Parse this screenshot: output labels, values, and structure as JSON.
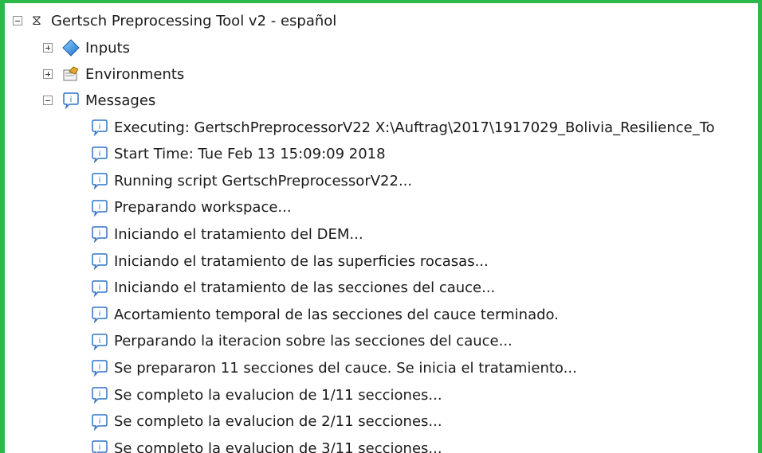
{
  "tree": {
    "root": {
      "label": "Gertsch Preprocessing Tool v2 - español",
      "icon": "hourglass-icon"
    },
    "nodes": [
      {
        "label": "Inputs",
        "icon": "inputs-diamond-icon",
        "expanded": false
      },
      {
        "label": "Environments",
        "icon": "environments-icon",
        "expanded": false
      },
      {
        "label": "Messages",
        "icon": "info-balloon-icon",
        "expanded": true
      }
    ],
    "messages": [
      "Executing: GertschPreprocessorV22 X:\\Auftrag\\2017\\1917029_Bolivia_Resilience_To",
      "Start Time: Tue Feb 13 15:09:09 2018",
      "Running script GertschPreprocessorV22...",
      "Preparando workspace...",
      "Iniciando el tratamiento del DEM...",
      "Iniciando el tratamiento de las superficies rocasas...",
      "Iniciando el tratamiento de las secciones del cauce...",
      "Acortamiento temporal de las secciones del cauce terminado.",
      "Perparando la iteracion sobre las secciones del cauce...",
      "Se prepararon 11 secciones del cauce. Se inicia el tratamiento...",
      "Se completo la evalucion de 1/11 secciones...",
      "Se completo la evalucion de 2/11 secciones...",
      "Se completo la evalucion de 3/11 secciones..."
    ]
  },
  "colors": {
    "frame": "#2db84a",
    "info_icon": "#2e74c8"
  }
}
